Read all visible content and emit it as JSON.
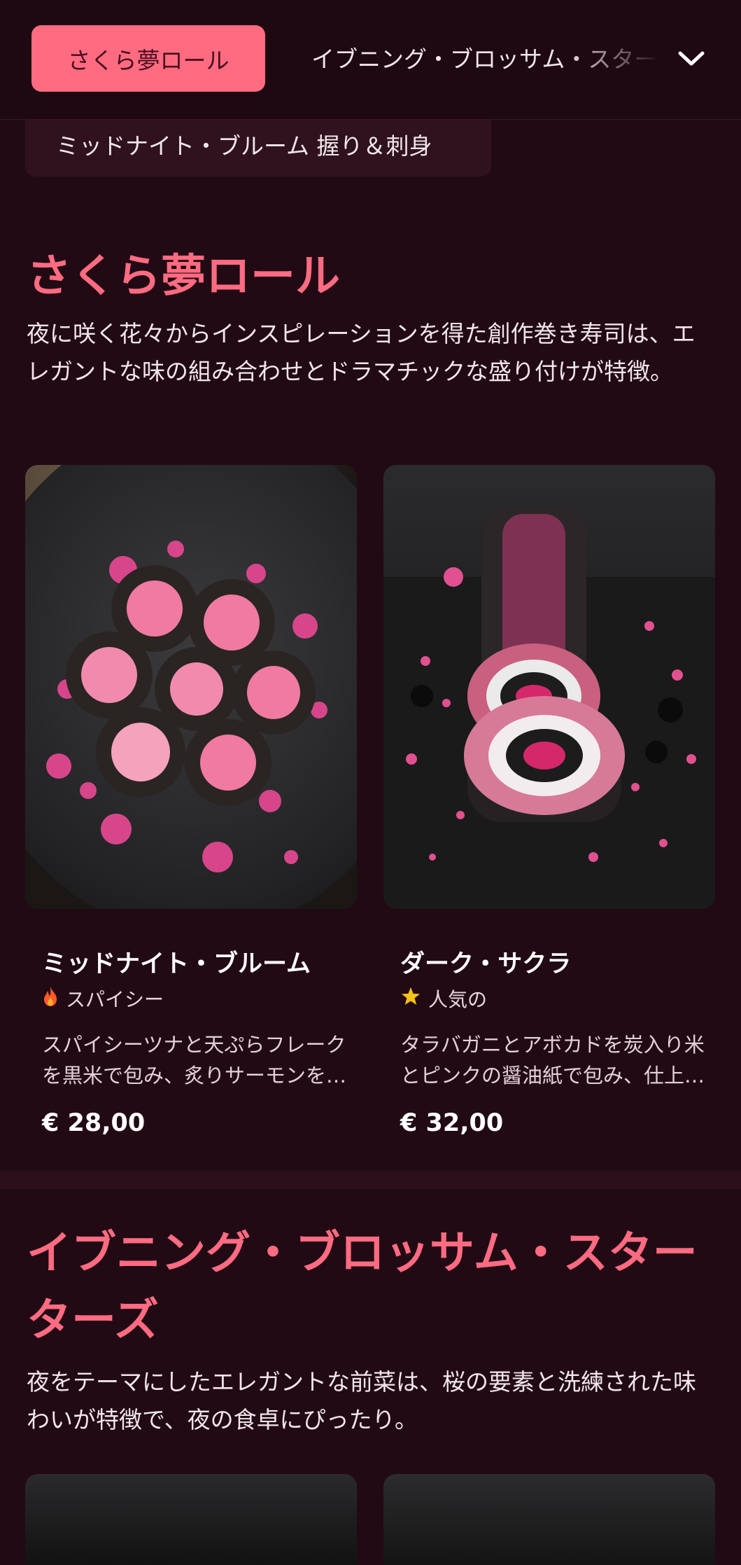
{
  "header": {
    "active_tab": "さくら夢ロール",
    "next_tab": "イブニング・ブロッサム・スターターズ",
    "expand_icon": "chevron-down-icon",
    "sub_tab": "ミッドナイト・ブルーム 握り＆刺身"
  },
  "sections": [
    {
      "title": "さくら夢ロール",
      "description": "夜に咲く花々からインスピレーションを得た創作巻き寿司は、エレガントな味の組み合わせとドラマチックな盛り付けが特徴。",
      "items": [
        {
          "name": "ミッドナイト・ブルーム",
          "tag": "スパイシー",
          "tag_icon": "flame-icon",
          "description": "スパイシーツナと天ぷらフレークを黒米で包み、炙りサーモンをのせた一品",
          "price": "€ 28,00"
        },
        {
          "name": "ダーク・サクラ",
          "tag": "人気の",
          "tag_icon": "star-icon",
          "description": "タラバガニとアボカドを炭入り米とピンクの醤油紙で包み、仕上げた一品",
          "price": "€ 32,00"
        }
      ]
    },
    {
      "title": "イブニング・ブロッサム・スターターズ",
      "description": "夜をテーマにしたエレガントな前菜は、桜の要素と洗練された味わいが特徴で、夜の食卓にぴったり。"
    }
  ],
  "colors": {
    "background": "#220a15",
    "accent": "#ff6b81",
    "active_tab_text": "#4a0e1f",
    "flame": "#ff5a2a",
    "star": "#f7c21a"
  }
}
